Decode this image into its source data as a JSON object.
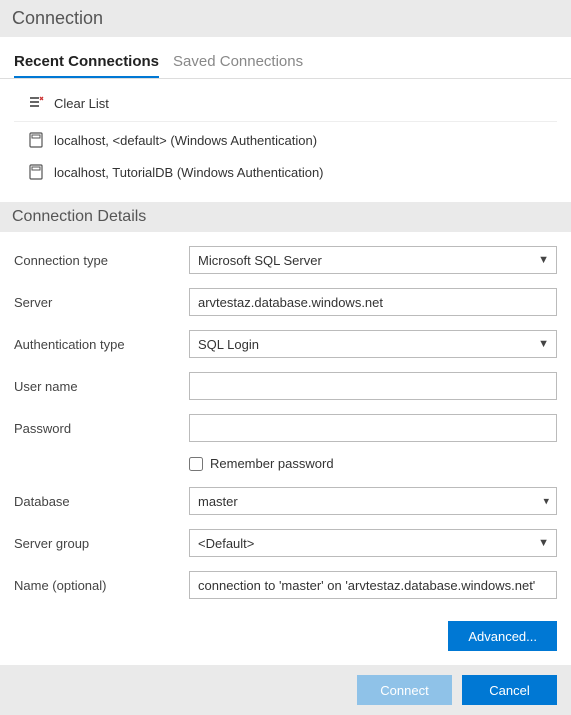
{
  "title": "Connection",
  "tabs": {
    "recent": "Recent Connections",
    "saved": "Saved Connections"
  },
  "recent": {
    "clear": "Clear List",
    "items": [
      "localhost, <default> (Windows Authentication)",
      "localhost, TutorialDB (Windows Authentication)"
    ]
  },
  "details": {
    "header": "Connection Details",
    "labels": {
      "conn_type": "Connection type",
      "server": "Server",
      "auth_type": "Authentication type",
      "user": "User name",
      "password": "Password",
      "remember": "Remember password",
      "database": "Database",
      "server_group": "Server group",
      "name": "Name (optional)"
    },
    "values": {
      "conn_type": "Microsoft SQL Server",
      "server": "arvtestaz.database.windows.net",
      "auth_type": "SQL Login",
      "user": "",
      "password": "",
      "database": "master",
      "server_group": "<Default>",
      "name": "connection to 'master' on 'arvtestaz.database.windows.net'"
    }
  },
  "buttons": {
    "advanced": "Advanced...",
    "connect": "Connect",
    "cancel": "Cancel"
  }
}
